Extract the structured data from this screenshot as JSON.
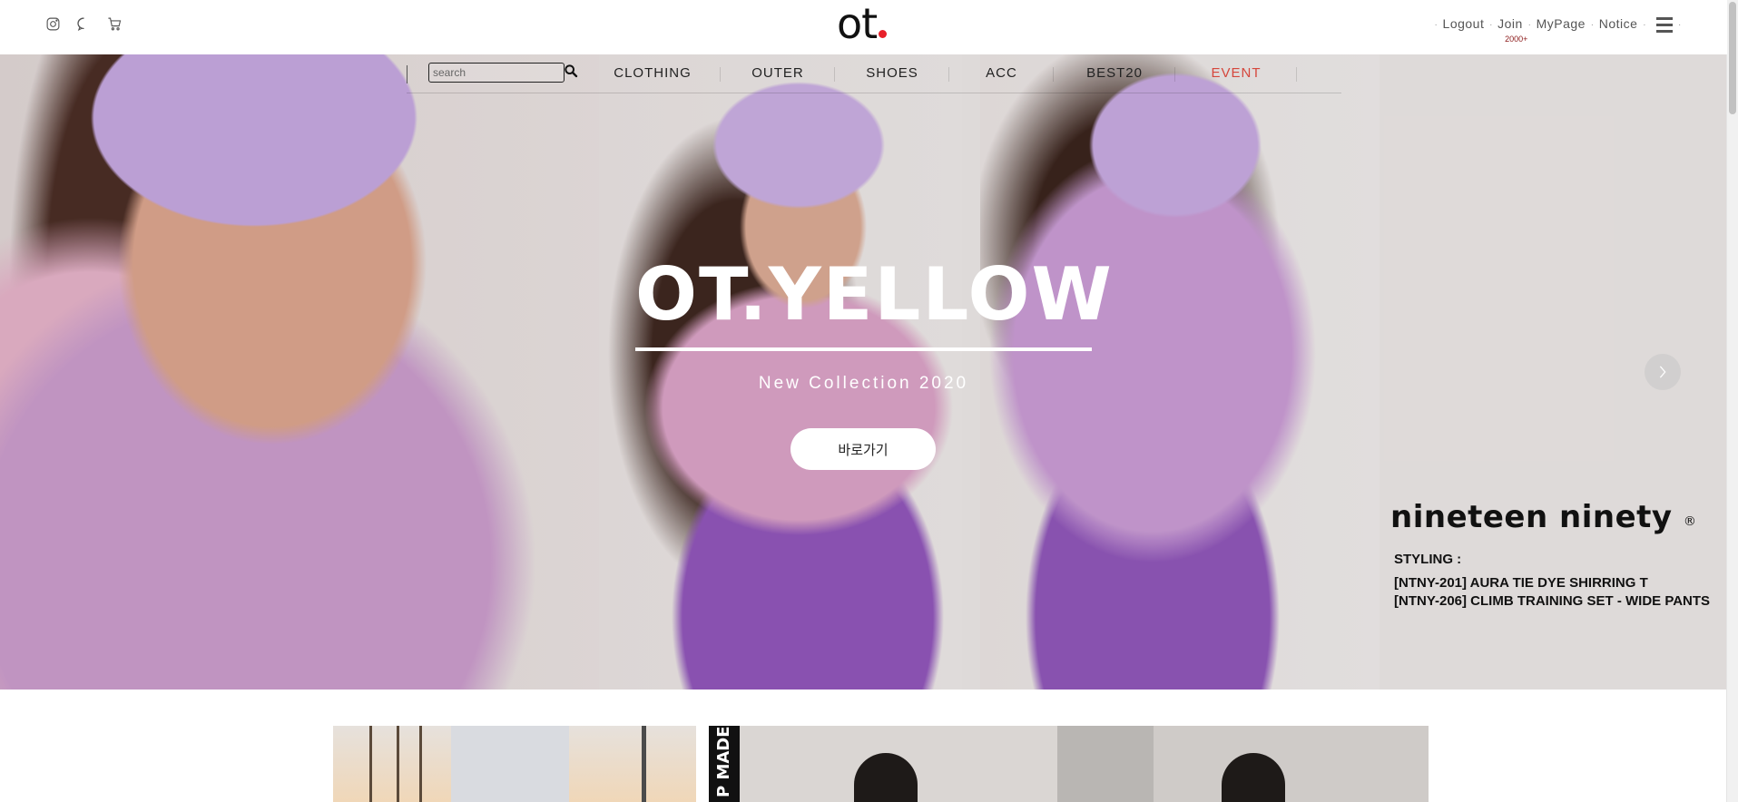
{
  "header": {
    "logo_text": "ot",
    "social_icons": [
      {
        "name": "instagram-icon"
      },
      {
        "name": "chat-icon"
      },
      {
        "name": "cart-icon"
      }
    ],
    "util_links": {
      "logout": "Logout",
      "join": "Join",
      "join_badge": "2000+",
      "mypage": "MyPage",
      "notice": "Notice"
    },
    "separator": "."
  },
  "nav": {
    "search_placeholder": "search",
    "items": [
      {
        "label": "CLOTHING"
      },
      {
        "label": "OUTER"
      },
      {
        "label": "SHOES"
      },
      {
        "label": "ACC"
      },
      {
        "label": "BEST20"
      },
      {
        "label": "EVENT"
      }
    ],
    "event_color": "#d5473c"
  },
  "hero": {
    "title": "OT.YELLOW",
    "subtitle": "New Collection 2020",
    "cta_label": "바로가기",
    "brand": "nineteen ninety",
    "brand_mark": "®",
    "styling_label": "STYLING :",
    "styling_items": [
      "[NTNY-201] AURA TIE DYE SHIRRING T",
      "[NTNY-206] CLIMB TRAINING SET - WIDE PANTS"
    ]
  },
  "banners": {
    "tag_text": "P MADE"
  },
  "colors": {
    "accent_red": "#e8202a",
    "event": "#d5473c"
  }
}
